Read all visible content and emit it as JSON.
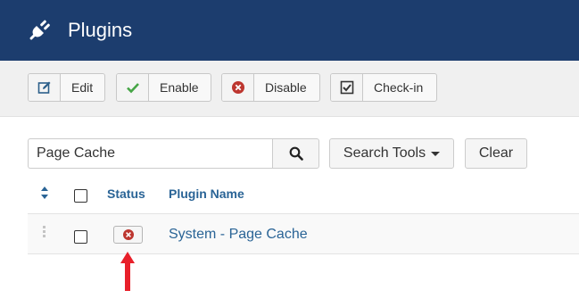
{
  "header": {
    "title": "Plugins",
    "icon": "plug-icon"
  },
  "toolbar": {
    "buttons": [
      {
        "label": "Edit",
        "icon": "edit-icon"
      },
      {
        "label": "Enable",
        "icon": "check-icon"
      },
      {
        "label": "Disable",
        "icon": "times-circle-icon"
      },
      {
        "label": "Check-in",
        "icon": "checkbox-checked-icon"
      }
    ]
  },
  "search": {
    "value": "Page Cache",
    "search_tools_label": "Search Tools",
    "clear_label": "Clear"
  },
  "table": {
    "columns": {
      "status": "Status",
      "plugin_name": "Plugin Name"
    },
    "rows": [
      {
        "plugin_name": "System - Page Cache",
        "status": "disabled"
      }
    ]
  },
  "colors": {
    "header_bg": "#1c3d6e",
    "link": "#2a6496",
    "enable": "#46a546",
    "disable": "#bd362f",
    "annotation_arrow": "#e8202a"
  }
}
